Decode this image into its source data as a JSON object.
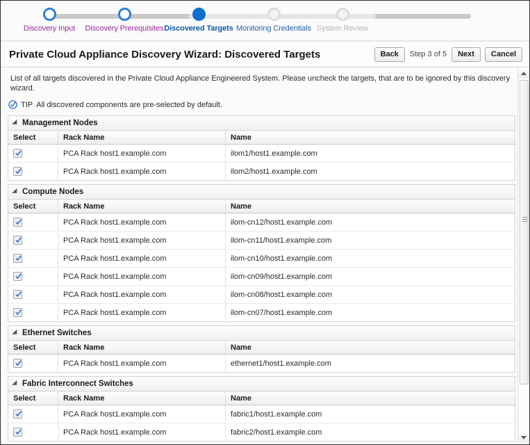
{
  "wizard": {
    "title": "Private Cloud Appliance Discovery Wizard: Discovered Targets",
    "step_count_label": "Step 3 of 5",
    "back_label": "Back",
    "next_label": "Next",
    "cancel_label": "Cancel",
    "intro": "List of all targets discovered in the Private Cloud Appliance Engineered System. Please uncheck the targets, that are to be ignored by this discovery wizard.",
    "tip_word": "TIP",
    "tip_text": "All discovered components are pre-selected by default."
  },
  "train": {
    "steps": [
      {
        "label": "Discovery Input",
        "state": "visited"
      },
      {
        "label": "Discovery Prerequisites",
        "state": "visited"
      },
      {
        "label": "Discovered Targets",
        "state": "active"
      },
      {
        "label": "Monitoring Credentials",
        "state": "link"
      },
      {
        "label": "System Review",
        "state": "future"
      }
    ]
  },
  "columns": {
    "select": "Select",
    "rack_name": "Rack Name",
    "name": "Name"
  },
  "sections": [
    {
      "title": "Management Nodes",
      "rows": [
        {
          "checked": true,
          "rack_name": "PCA Rack host1.example.com",
          "name": "ilom1/host1.example.com"
        },
        {
          "checked": true,
          "rack_name": "PCA Rack host1.example.com",
          "name": "ilom2/host1.example.com"
        }
      ]
    },
    {
      "title": "Compute Nodes",
      "rows": [
        {
          "checked": true,
          "rack_name": "PCA Rack host1.example.com",
          "name": "ilom-cn12/host1.example.com"
        },
        {
          "checked": true,
          "rack_name": "PCA Rack host1.example.com",
          "name": "ilom-cn11/host1.example.com"
        },
        {
          "checked": true,
          "rack_name": "PCA Rack host1.example.com",
          "name": "ilom-cn10/host1.example.com"
        },
        {
          "checked": true,
          "rack_name": "PCA Rack host1.example.com",
          "name": "ilom-cn09/host1.example.com"
        },
        {
          "checked": true,
          "rack_name": "PCA Rack host1.example.com",
          "name": "ilom-cn08/host1.example.com"
        },
        {
          "checked": true,
          "rack_name": "PCA Rack host1.example.com",
          "name": "ilom-cn07/host1.example.com"
        }
      ]
    },
    {
      "title": "Ethernet Switches",
      "rows": [
        {
          "checked": true,
          "rack_name": "PCA Rack host1.example.com",
          "name": "ethernet1/host1.example.com"
        }
      ]
    },
    {
      "title": "Fabric Interconnect Switches",
      "rows": [
        {
          "checked": true,
          "rack_name": "PCA Rack host1.example.com",
          "name": "fabric1/host1.example.com"
        },
        {
          "checked": true,
          "rack_name": "PCA Rack host1.example.com",
          "name": "fabric2/host1.example.com"
        }
      ]
    }
  ],
  "colors": {
    "active": "#0f6fd1",
    "visited": "#9b2a9b",
    "link": "#2463a8",
    "disabled": "#b6b6b6"
  }
}
